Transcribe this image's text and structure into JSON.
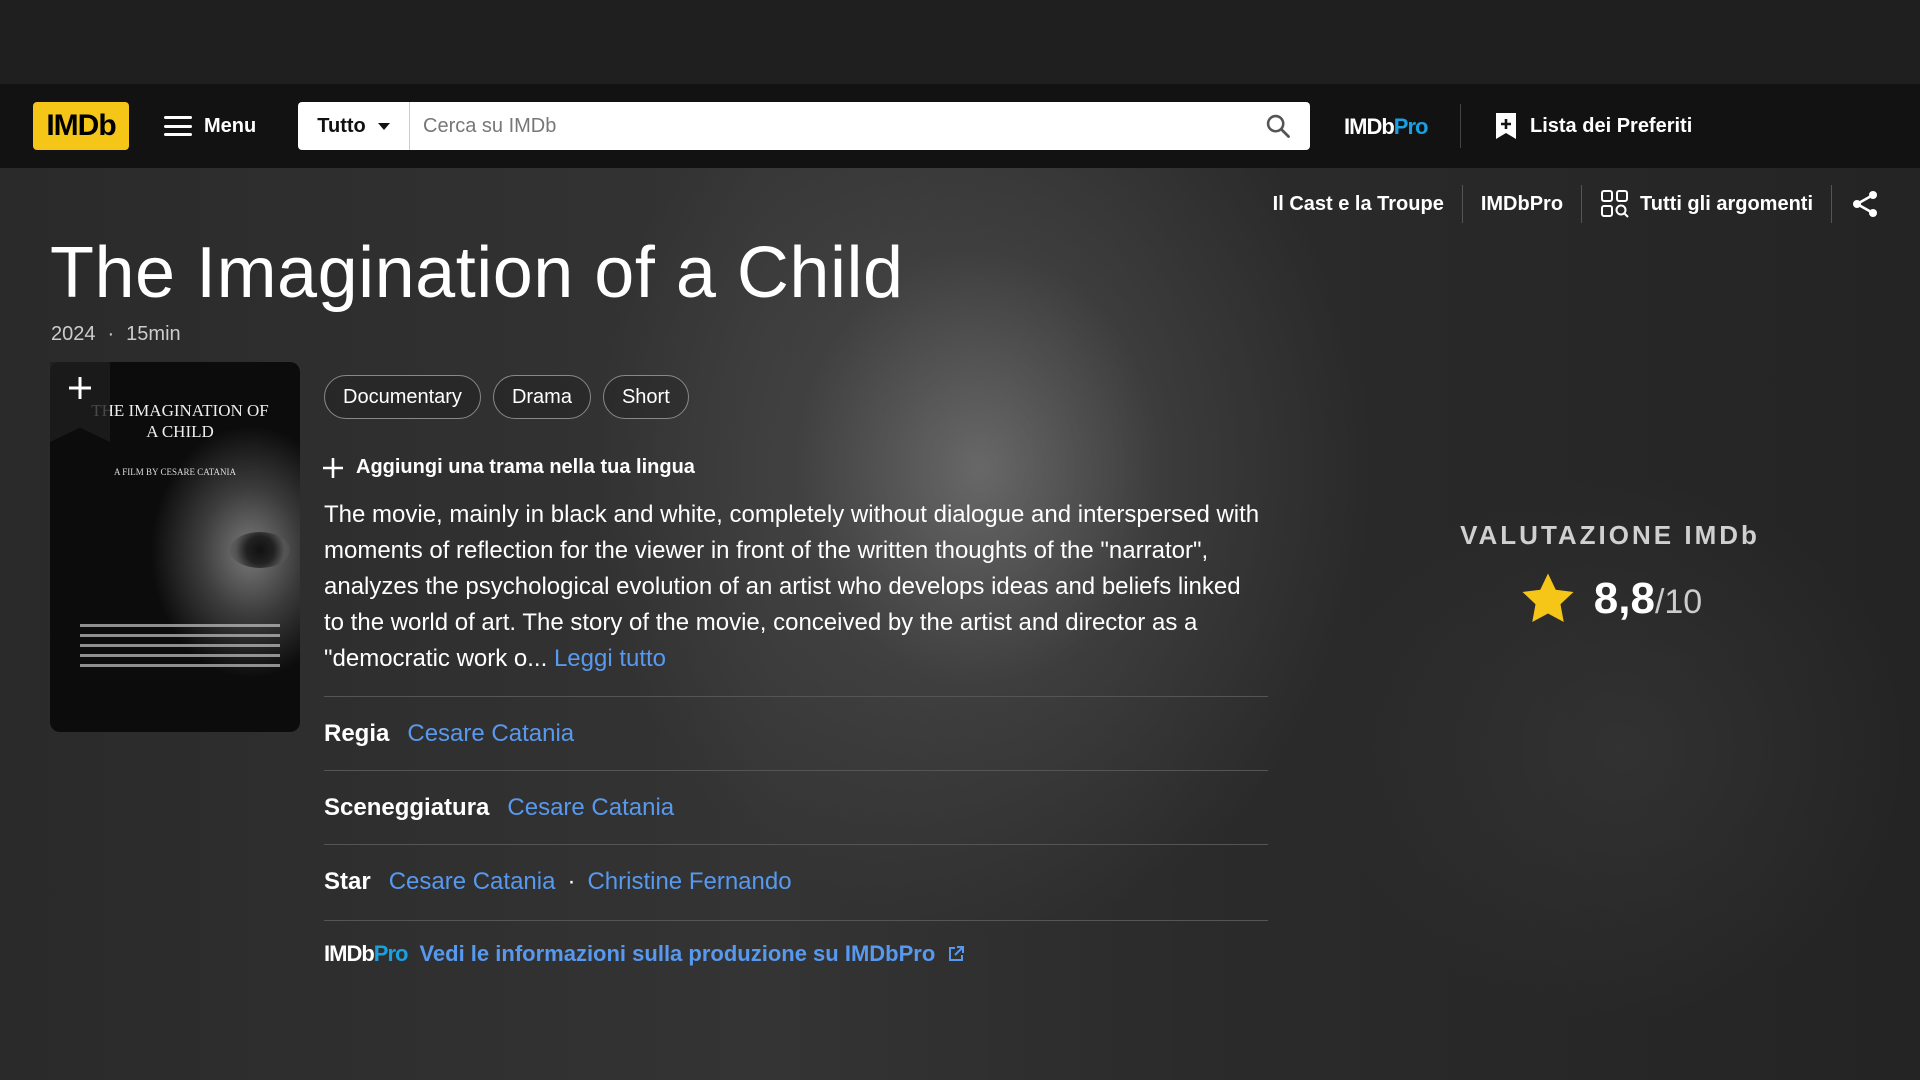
{
  "navbar": {
    "logo": "IMDb",
    "menu_label": "Menu",
    "search_category": "Tutto",
    "search_placeholder": "Cerca su IMDb",
    "imdbpro_main": "IMDb",
    "imdbpro_suffix": "Pro",
    "watchlist_label": "Lista dei Preferiti"
  },
  "subnav": {
    "cast": "Il Cast e la Troupe",
    "imdbpro": "IMDbPro",
    "topics": "Tutti gli argomenti"
  },
  "title": {
    "name": "The Imagination of a Child",
    "year": "2024",
    "separator": "·",
    "runtime": "15min"
  },
  "poster": {
    "title_text": "THE IMAGINATION OF A CHILD",
    "film_by": "A FILM BY CESARE CATANIA"
  },
  "genres": [
    "Documentary",
    "Drama",
    "Short"
  ],
  "add_plot_label": "Aggiungi una trama nella tua lingua",
  "plot": {
    "text": "The movie, mainly in black and white, completely without dialogue and interspersed with moments of reflection for the viewer in front of the written thoughts of the \"narrator\", analyzes the psychological evolution of an artist who develops ideas and beliefs linked to the world of art. The story of the movie, conceived by the artist and director as a \"democratic work o...",
    "read_more": "Leggi tutto"
  },
  "credits": {
    "director_label": "Regia",
    "director": "Cesare Catania",
    "writer_label": "Sceneggiatura",
    "writer": "Cesare Catania",
    "stars_label": "Star",
    "star_1": "Cesare Catania",
    "star_sep": "·",
    "star_2": "Christine Fernando"
  },
  "pro_link": {
    "logo_main": "IMDb",
    "logo_suffix": "Pro",
    "text": "Vedi le informazioni sulla produzione su IMDbPro"
  },
  "rating": {
    "label": "VALUTAZIONE IMDb",
    "value": "8,8",
    "max": "/10",
    "star_color": "#f5c518"
  },
  "colors": {
    "brand_yellow": "#f5c518",
    "link_blue": "#5799ef",
    "pro_blue": "#1a9fe0"
  }
}
